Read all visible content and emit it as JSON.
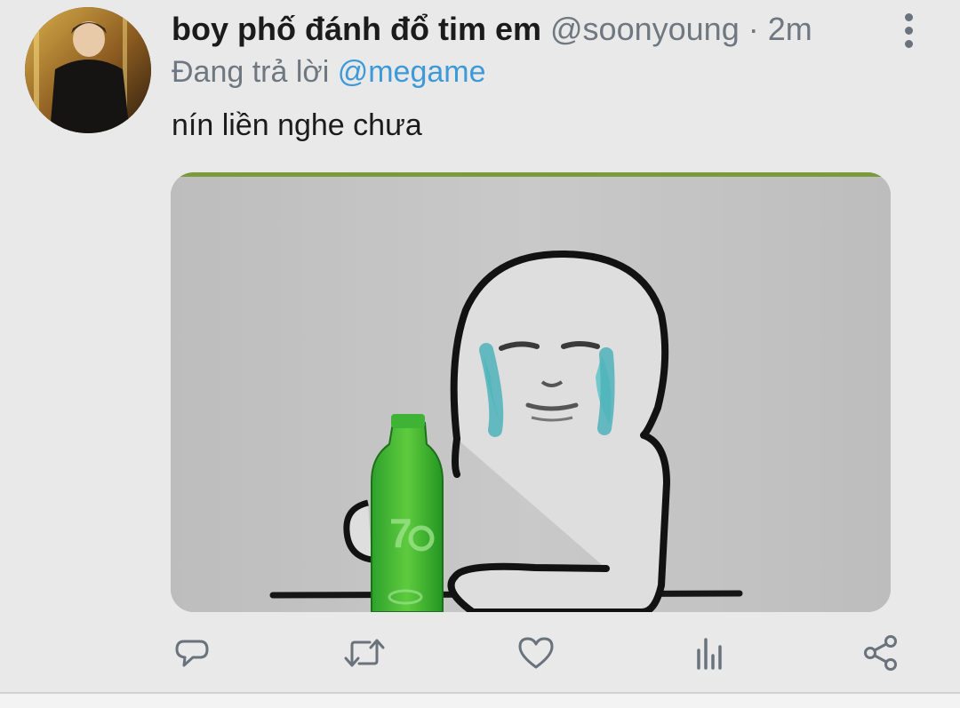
{
  "tweet": {
    "display_name": "boy phố đánh đổ tim em",
    "handle": "@soonyoung",
    "separator": "·",
    "time": "2m",
    "reply_prefix": "Đang trả lời",
    "reply_to": "@megame",
    "text": "nín liền nghe chưa",
    "media_alt": "meme: crying character holding a green bottle"
  },
  "colors": {
    "background": "#e9e9e9",
    "mention": "#3d9ad9",
    "muted": "#6f7780",
    "icon": "#6a737c"
  },
  "actions": {
    "reply_icon": "comment-icon",
    "retweet_icon": "retweet-icon",
    "like_icon": "heart-icon",
    "stats_icon": "analytics-icon",
    "share_icon": "share-icon",
    "more_icon": "more-vertical-icon"
  }
}
